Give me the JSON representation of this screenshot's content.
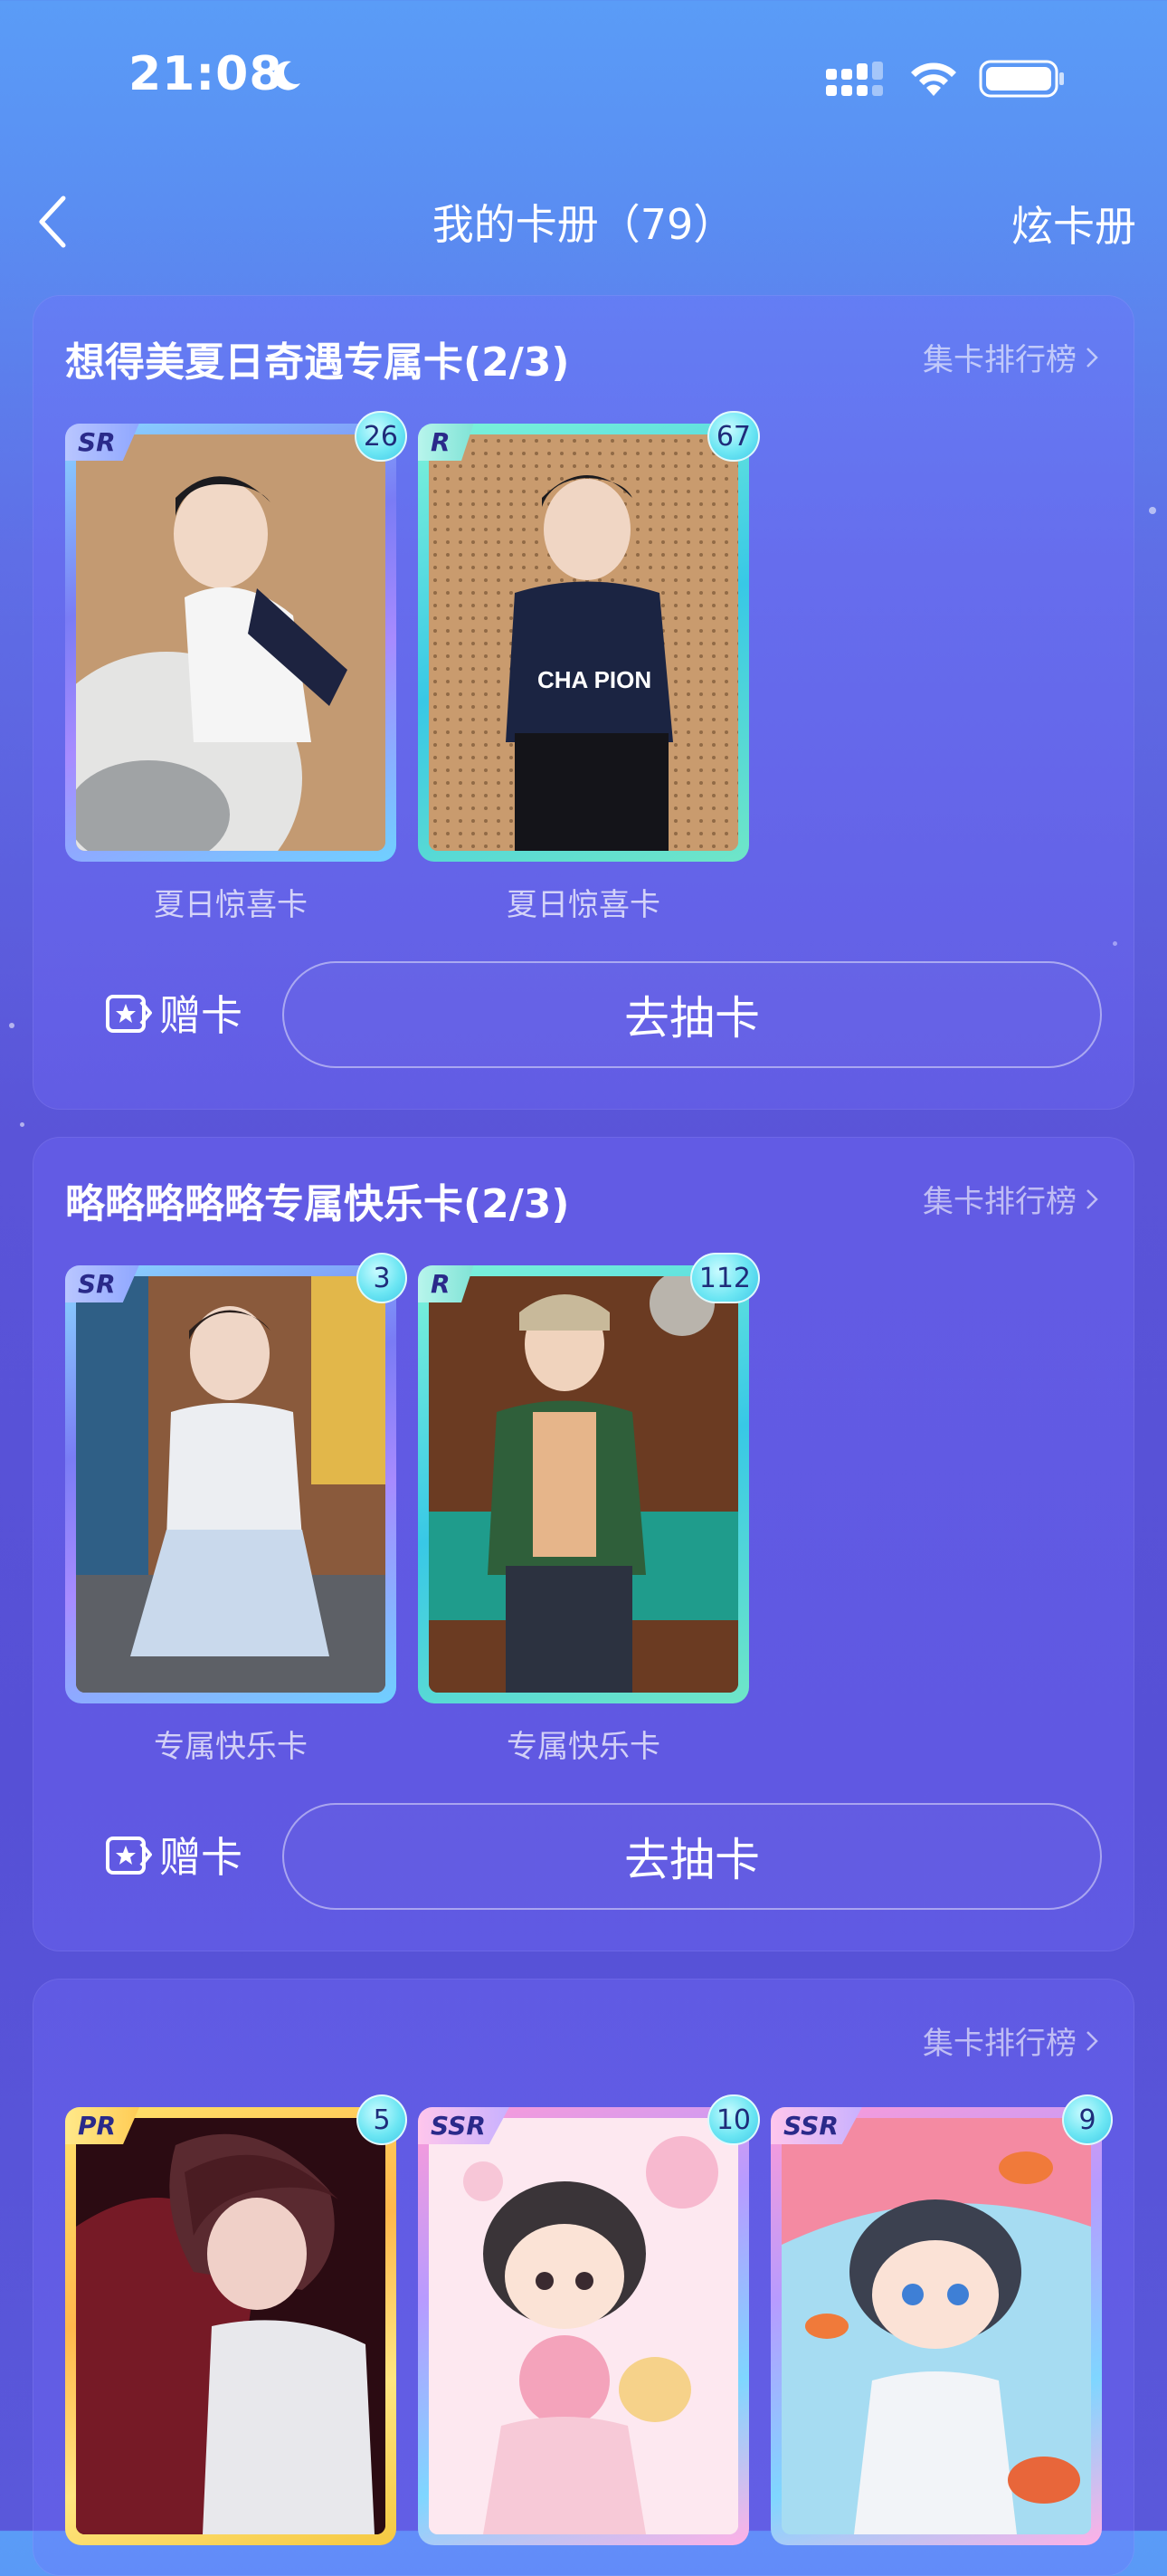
{
  "status_bar": {
    "time": "21:08"
  },
  "nav": {
    "title": "我的卡册（79）",
    "action_label": "炫卡册"
  },
  "sections": [
    {
      "title": "想得美夏日奇遇专属卡(2/3)",
      "rank_label": "集卡排行榜",
      "cards": [
        {
          "rarity": "SR",
          "count": "26",
          "label": "夏日惊喜卡"
        },
        {
          "rarity": "R",
          "count": "67",
          "label": "夏日惊喜卡"
        }
      ],
      "gift_label": "赠卡",
      "draw_label": "去抽卡"
    },
    {
      "title": "略略略略略专属快乐卡(2/3)",
      "rank_label": "集卡排行榜",
      "cards": [
        {
          "rarity": "SR",
          "count": "3",
          "label": "专属快乐卡"
        },
        {
          "rarity": "R",
          "count": "112",
          "label": "专属快乐卡"
        }
      ],
      "gift_label": "赠卡",
      "draw_label": "去抽卡"
    },
    {
      "title": "",
      "rank_label": "集卡排行榜",
      "cards": [
        {
          "rarity": "PR",
          "count": "5"
        },
        {
          "rarity": "SSR",
          "count": "10"
        },
        {
          "rarity": "SSR",
          "count": "9"
        }
      ]
    }
  ],
  "colors": {
    "background_top": "#5a9cf7",
    "background_bottom": "#5650d6",
    "badge": "#6ce6f3",
    "frame_r": "#38c8e6",
    "frame_pr": "#ffcc55"
  }
}
